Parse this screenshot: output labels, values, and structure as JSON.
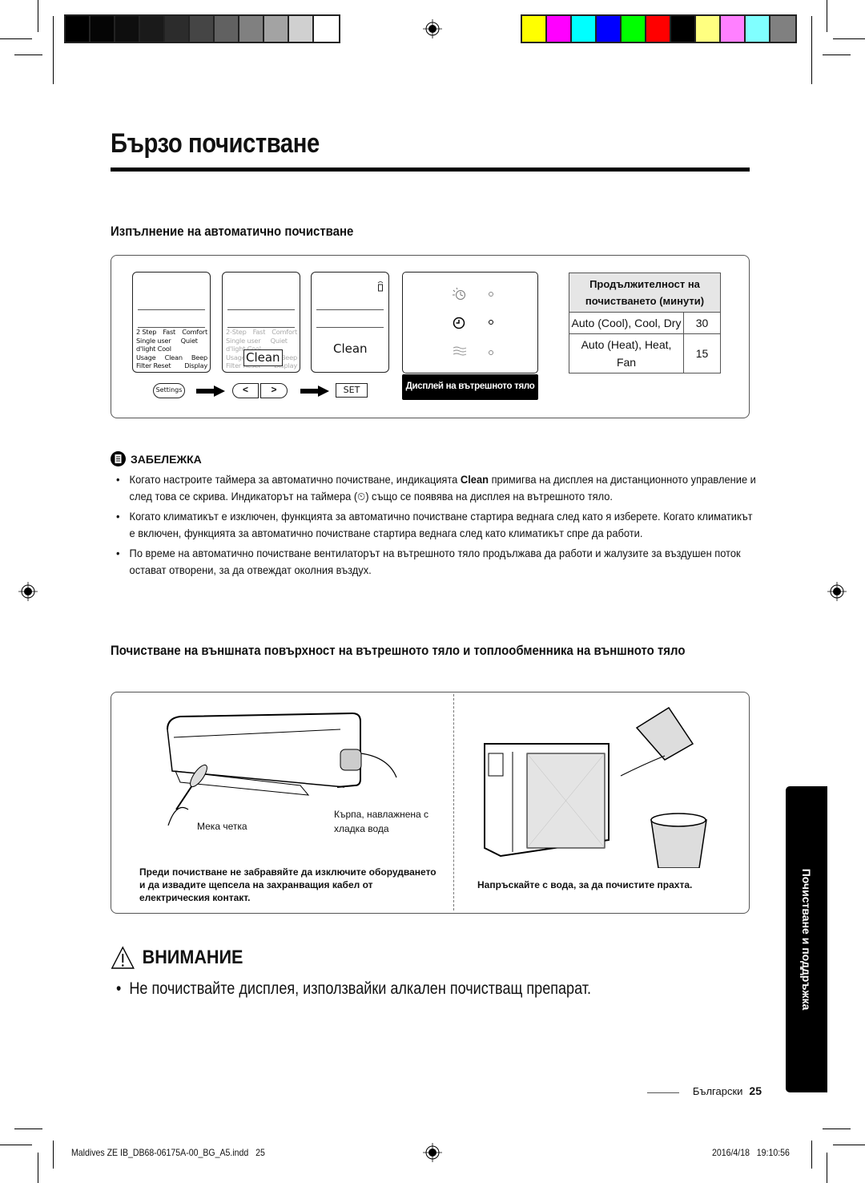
{
  "print_marks": {
    "grayscale_swatches": [
      "#000000",
      "#050505",
      "#0e0e0e",
      "#1a1a1a",
      "#2c2c2c",
      "#454545",
      "#616161",
      "#808080",
      "#a3a3a3",
      "#d0d0d0",
      "#ffffff"
    ],
    "color_swatches": [
      "#ffff00",
      "#ff00ff",
      "#00ffff",
      "#0000ff",
      "#00ff00",
      "#ff0000",
      "#000000",
      "#ffff80",
      "#ff80ff",
      "#80ffff",
      "#808080"
    ]
  },
  "page": {
    "title": "Бързо почистване",
    "section1": {
      "heading": "Изпълнение на автоматично почистване",
      "remote_screens": {
        "options_rows": [
          [
            "2 Step",
            "Fast",
            "Comfort"
          ],
          [
            "Single user",
            "Quiet",
            ""
          ],
          [
            "d'light Cool",
            "",
            ""
          ],
          [
            "Usage",
            "Clean",
            "Beep"
          ],
          [
            "Filter Reset",
            "",
            "Display"
          ]
        ],
        "options_rows_dim": [
          [
            "2-Step",
            "Fast",
            "Comfort"
          ],
          [
            "Single user",
            "Quiet",
            ""
          ],
          [
            "d'light Cool",
            "",
            ""
          ],
          [
            "Usage",
            "Clean",
            "Beep"
          ],
          [
            "Filter Reset",
            "",
            "Display"
          ]
        ],
        "clean_label": "Clean",
        "buttons": {
          "settings": "Settings",
          "left": "<",
          "right": ">",
          "set": "SET"
        }
      },
      "indoor_display_label": "Дисплей на вътрешното тяло",
      "duration_table": {
        "header": "Продължителност на почистването (минути)",
        "rows": [
          {
            "modes": "Auto (Cool), Cool, Dry",
            "minutes": "30"
          },
          {
            "modes": "Auto (Heat), Heat, Fan",
            "minutes": "15"
          }
        ]
      }
    },
    "note": {
      "heading": "ЗАБЕЛЕЖКА",
      "items": [
        {
          "pre": "Когато настроите таймера за автоматично почистване, индикацията ",
          "bold": "Clean",
          "post": " примигва на дисплея на дистанционното управление и след това се скрива. Индикаторът на таймера (⏲) също се появява на дисплея на вътрешното тяло."
        },
        {
          "pre": "Когато климатикът е изключен, функцията за автоматично почистване стартира веднага след като я изберете. Когато климатикът е включен, функцията за автоматично почистване стартира веднага след като климатикът спре да работи.",
          "bold": "",
          "post": ""
        },
        {
          "pre": "По време на автоматично почистване вентилаторът на вътрешното тяло продължава да работи и жалузите за въздушен поток остават отворени, за да отвеждат околния въздух.",
          "bold": "",
          "post": ""
        }
      ]
    },
    "section2": {
      "heading": "Почистване на външната повърхност на вътрешното тяло и топлообменника на външното тяло",
      "left_figure": {
        "brush_label": "Мека четка",
        "cloth_label": "Кърпа, навлажнена с хладка вода",
        "caption": "Преди почистване не забравяйте да изключите оборудването и да извадите щепсела на захранващия кабел от електрическия контакт."
      },
      "right_figure": {
        "caption": "Напръскайте с вода, за да почистите прахта."
      }
    },
    "warning": {
      "heading": "ВНИМАНИЕ",
      "items": [
        "Не почиствайте дисплея, използвайки алкален почистващ препарат."
      ]
    },
    "side_tab": "Почистване и поддръжка",
    "footer": {
      "language": "Български",
      "page_number": "25"
    }
  },
  "slug": {
    "file": "Maldives ZE IB_DB68-06175A-00_BG_A5.indd   25",
    "timestamp": "2016/4/18   19:10:56"
  }
}
